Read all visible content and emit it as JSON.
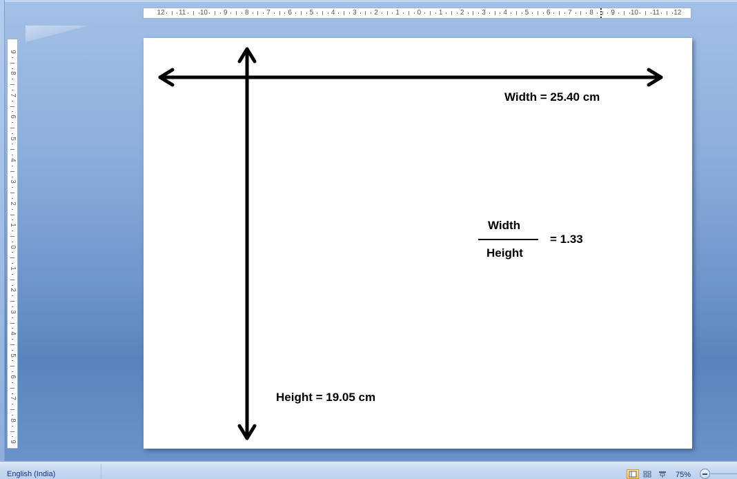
{
  "app": {
    "status_bar": {
      "language": "English (India)",
      "zoom_level": "75%",
      "view_buttons": [
        {
          "name": "print-layout",
          "active": true
        },
        {
          "name": "full-screen-reading",
          "active": false
        },
        {
          "name": "web-layout",
          "active": false
        }
      ]
    },
    "horizontal_ruler": {
      "labels": [
        "12",
        "11",
        "10",
        "9",
        "8",
        "7",
        "6",
        "5",
        "4",
        "3",
        "2",
        "1",
        "0",
        "1",
        "2",
        "3",
        "4",
        "5",
        "6",
        "7",
        "8",
        "9",
        "10",
        "11",
        "12"
      ]
    },
    "vertical_ruler": {
      "labels": [
        "9",
        "8",
        "7",
        "6",
        "5",
        "4",
        "3",
        "2",
        "1",
        "0",
        "1",
        "2",
        "3",
        "4",
        "5",
        "6",
        "7",
        "8",
        "9"
      ]
    }
  },
  "slide": {
    "width_label": "Width = 25.40 cm",
    "height_label": "Height = 19.05 cm",
    "ratio": {
      "numerator": "Width",
      "denominator": "Height",
      "result": "= 1.33"
    }
  }
}
